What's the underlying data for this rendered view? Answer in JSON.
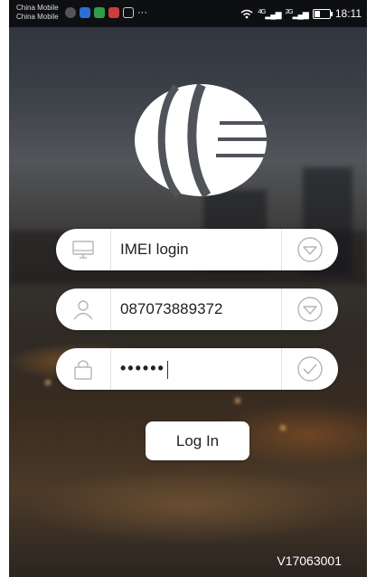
{
  "status_bar": {
    "carrier_line1": "China Mobile",
    "carrier_line2": "China Mobile",
    "more": "···",
    "signal1": "4G",
    "signal2": "2G",
    "time": "18:11",
    "battery_level": 0.4
  },
  "login_form": {
    "mode": {
      "value": "IMEI login",
      "left_icon": "monitor-icon",
      "right_icon": "dropdown-circle-icon"
    },
    "account": {
      "value": "087073889372",
      "left_icon": "user-icon",
      "right_icon": "dropdown-circle-icon"
    },
    "password": {
      "value": "••••••",
      "left_icon": "lock-icon",
      "right_icon": "check-circle-icon"
    },
    "login_label": "Log In"
  },
  "version": "V17063001",
  "colors": {
    "field_bg": "#ffffff",
    "icon_gray": "#b5b5b5",
    "status_bg": "#0e0f12"
  }
}
